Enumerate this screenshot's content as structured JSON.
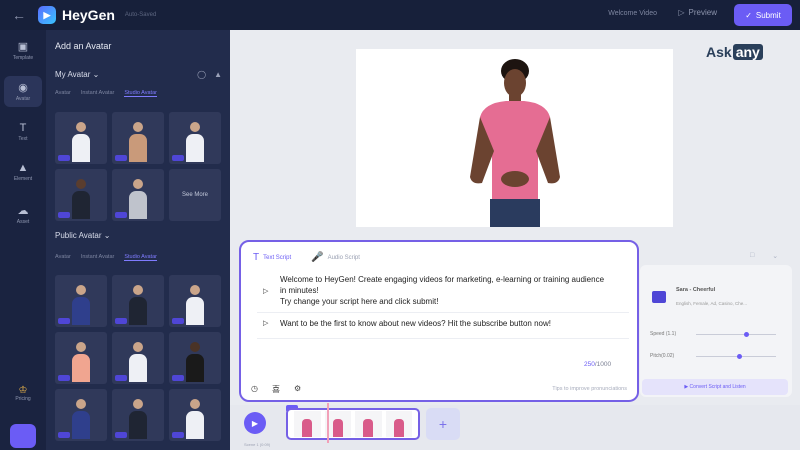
{
  "header": {
    "back_icon": "arrow-left-icon",
    "brand": "HeyGen",
    "autosave": "Auto-Saved",
    "welcome_video": "Welcome Video",
    "preview_label": "Preview",
    "submit_label": "Submit",
    "accent": "#6b5cf5"
  },
  "leftnav": {
    "items": [
      {
        "label": "Template",
        "icon": "template-icon"
      },
      {
        "label": "Avatar",
        "icon": "avatar-icon"
      },
      {
        "label": "Text",
        "icon": "text-icon"
      },
      {
        "label": "Element",
        "icon": "element-icon"
      },
      {
        "label": "Asset",
        "icon": "asset-icon"
      }
    ],
    "pricing": "Pricing"
  },
  "gallery": {
    "title": "Add an Avatar",
    "my_avatar": "My Avatar",
    "my_tabs": [
      "Avatar",
      "Instant Avatar",
      "Studio Avatar"
    ],
    "see_more": "See More",
    "public_avatar": "Public Avatar",
    "public_tabs": [
      "Avatar",
      "Instant Avatar",
      "Studio Avatar"
    ]
  },
  "watermark": {
    "ask": "Ask",
    "any": "any"
  },
  "editor": {
    "tab_text": "Text Script",
    "tab_audio": "Audio Script",
    "line1a": "Welcome to HeyGen! Create engaging videos for marketing, e-learning or training audience",
    "line1b": "in minutes!",
    "line1c": "Try change your script here and click submit!",
    "line2": "Want to be the first to know about new videos? Hit the subscribe button now!",
    "count_current": "250",
    "count_max": "/1000",
    "tips": "Tips to improve pronunciations"
  },
  "voice": {
    "name": "Sara - Cheerful",
    "details": "English, Female, Ad, Casino, Che...",
    "speed_label": "Speed (1.1)",
    "speed_value": 1.1,
    "pitch_label": "Pitch(0.02)",
    "pitch_value": 0.02,
    "convert_label": "Convert Script and Listen"
  },
  "timeline": {
    "scene_count": 1,
    "bottom_label": "Scene 1 (0:09)"
  }
}
